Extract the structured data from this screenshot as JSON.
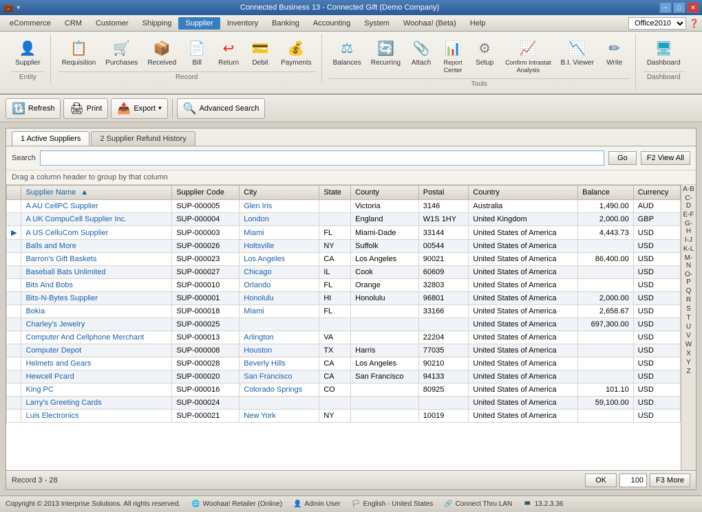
{
  "titlebar": {
    "title": "Connected Business 13 - Connected Gift (Demo Company)",
    "quick_access": [
      "save",
      "undo",
      "customize"
    ]
  },
  "menubar": {
    "items": [
      "eCommerce",
      "CRM",
      "Customer",
      "Shipping",
      "Supplier",
      "Inventory",
      "Banking",
      "Accounting",
      "System",
      "Woohaa! (Beta)",
      "Help"
    ],
    "active": "Supplier",
    "theme": "Office2010"
  },
  "ribbon": {
    "groups": [
      {
        "label": "Entity",
        "items": [
          {
            "id": "supplier",
            "label": "Supplier",
            "icon": "👤"
          }
        ]
      },
      {
        "label": "Record",
        "items": [
          {
            "id": "requisition",
            "label": "Requisition",
            "icon": "📋"
          },
          {
            "id": "purchases",
            "label": "Purchases",
            "icon": "🛒"
          },
          {
            "id": "received",
            "label": "Received",
            "icon": "📦"
          },
          {
            "id": "bill",
            "label": "Bill",
            "icon": "📄"
          },
          {
            "id": "return",
            "label": "Return",
            "icon": "↩"
          },
          {
            "id": "debit",
            "label": "Debit",
            "icon": "💳"
          },
          {
            "id": "payments",
            "label": "Payments",
            "icon": "💰"
          }
        ]
      },
      {
        "label": "Tools",
        "items": [
          {
            "id": "balances",
            "label": "Balances",
            "icon": "⚖"
          },
          {
            "id": "recurring",
            "label": "Recurring",
            "icon": "🔄"
          },
          {
            "id": "attach",
            "label": "Attach",
            "icon": "📎"
          },
          {
            "id": "report-center",
            "label": "Report\nCenter",
            "icon": "📊"
          },
          {
            "id": "setup",
            "label": "Setup",
            "icon": "⚙"
          },
          {
            "id": "confirm-intrastat",
            "label": "Confirm Intrastat\nAnalysis",
            "icon": "📈"
          },
          {
            "id": "bi-viewer",
            "label": "B.I. Viewer",
            "icon": "📉"
          },
          {
            "id": "write",
            "label": "Write",
            "icon": "✏"
          }
        ]
      },
      {
        "label": "Dashboard",
        "items": [
          {
            "id": "dashboard",
            "label": "Dashboard",
            "icon": "🖥"
          }
        ]
      }
    ]
  },
  "toolbar": {
    "refresh_label": "Refresh",
    "print_label": "Print",
    "export_label": "Export",
    "advanced_search_label": "Advanced Search"
  },
  "tabs": [
    {
      "id": "active-suppliers",
      "label": "1 Active Suppliers",
      "active": true
    },
    {
      "id": "supplier-refund",
      "label": "2 Supplier Refund History",
      "active": false
    }
  ],
  "search": {
    "label": "Search",
    "placeholder": "",
    "value": "",
    "go_label": "Go",
    "f2_label": "F2 View All"
  },
  "drag_hint": "Drag a column header to group by that column",
  "table": {
    "columns": [
      {
        "id": "name",
        "label": "Supplier Name",
        "sorted": true
      },
      {
        "id": "code",
        "label": "Supplier Code"
      },
      {
        "id": "city",
        "label": "City"
      },
      {
        "id": "state",
        "label": "State"
      },
      {
        "id": "county",
        "label": "County"
      },
      {
        "id": "postal",
        "label": "Postal"
      },
      {
        "id": "country",
        "label": "Country"
      },
      {
        "id": "balance",
        "label": "Balance"
      },
      {
        "id": "currency",
        "label": "Currency"
      }
    ],
    "rows": [
      {
        "name": "A AU CellPC Supplier",
        "code": "SUP-000005",
        "city": "Glen Iris",
        "state": "",
        "county": "Victoria",
        "postal": "3146",
        "country": "Australia",
        "balance": "1,490.00",
        "currency": "AUD",
        "selected": false,
        "arrow": false
      },
      {
        "name": "A UK CompuCell Supplier Inc.",
        "code": "SUP-000004",
        "city": "London",
        "state": "",
        "county": "England",
        "postal": "W1S 1HY",
        "country": "United Kingdom",
        "balance": "2,000.00",
        "currency": "GBP",
        "selected": false,
        "arrow": false
      },
      {
        "name": "A US CelluCom Supplier",
        "code": "SUP-000003",
        "city": "Miami",
        "state": "FL",
        "county": "Miami-Dade",
        "postal": "33144",
        "country": "United States of America",
        "balance": "4,443.73",
        "currency": "USD",
        "selected": false,
        "arrow": true
      },
      {
        "name": "Balls and More",
        "code": "SUP-000026",
        "city": "Holtsville",
        "state": "NY",
        "county": "Suffolk",
        "postal": "00544",
        "country": "United States of America",
        "balance": "",
        "currency": "USD",
        "selected": false,
        "arrow": false
      },
      {
        "name": "Barron's Gift Baskets",
        "code": "SUP-000023",
        "city": "Los Angeles",
        "state": "CA",
        "county": "Los Angeles",
        "postal": "90021",
        "country": "United States of America",
        "balance": "86,400.00",
        "currency": "USD",
        "selected": false,
        "arrow": false
      },
      {
        "name": "Baseball Bats Unlimited",
        "code": "SUP-000027",
        "city": "Chicago",
        "state": "IL",
        "county": "Cook",
        "postal": "60609",
        "country": "United States of America",
        "balance": "",
        "currency": "USD",
        "selected": false,
        "arrow": false
      },
      {
        "name": "Bits And Bobs",
        "code": "SUP-000010",
        "city": "Orlando",
        "state": "FL",
        "county": "Orange",
        "postal": "32803",
        "country": "United States of America",
        "balance": "",
        "currency": "USD",
        "selected": false,
        "arrow": false
      },
      {
        "name": "Bits-N-Bytes Supplier",
        "code": "SUP-000001",
        "city": "Honolulu",
        "state": "HI",
        "county": "Honolulu",
        "postal": "96801",
        "country": "United States of America",
        "balance": "2,000.00",
        "currency": "USD",
        "selected": false,
        "arrow": false
      },
      {
        "name": "Bokia",
        "code": "SUP-000018",
        "city": "Miami",
        "state": "FL",
        "county": "",
        "postal": "33166",
        "country": "United States of America",
        "balance": "2,658.67",
        "currency": "USD",
        "selected": false,
        "arrow": false
      },
      {
        "name": "Charley's Jewelry",
        "code": "SUP-000025",
        "city": "",
        "state": "",
        "county": "",
        "postal": "",
        "country": "United States of America",
        "balance": "697,300.00",
        "currency": "USD",
        "selected": false,
        "arrow": false
      },
      {
        "name": "Computer And Cellphone Merchant",
        "code": "SUP-000013",
        "city": "Arlington",
        "state": "VA",
        "county": "",
        "postal": "22204",
        "country": "United States of America",
        "balance": "",
        "currency": "USD",
        "selected": false,
        "arrow": false
      },
      {
        "name": "Computer Depot",
        "code": "SUP-000008",
        "city": "Houston",
        "state": "TX",
        "county": "Harris",
        "postal": "77035",
        "country": "United States of America",
        "balance": "",
        "currency": "USD",
        "selected": false,
        "arrow": false
      },
      {
        "name": "Helmets and Gears",
        "code": "SUP-000028",
        "city": "Beverly Hills",
        "state": "CA",
        "county": "Los Angeles",
        "postal": "90210",
        "country": "United States of America",
        "balance": "",
        "currency": "USD",
        "selected": false,
        "arrow": false
      },
      {
        "name": "Hewcell Pcard",
        "code": "SUP-000020",
        "city": "San Francisco",
        "state": "CA",
        "county": "San Francisco",
        "postal": "94133",
        "country": "United States of America",
        "balance": "",
        "currency": "USD",
        "selected": false,
        "arrow": false
      },
      {
        "name": "King PC",
        "code": "SUP-000016",
        "city": "Colorado Springs",
        "state": "CO",
        "county": "",
        "postal": "80925",
        "country": "United States of America",
        "balance": "101.10",
        "currency": "USD",
        "selected": false,
        "arrow": false
      },
      {
        "name": "Larry's Greeting Cards",
        "code": "SUP-000024",
        "city": "",
        "state": "",
        "county": "",
        "postal": "",
        "country": "United States of America",
        "balance": "59,100.00",
        "currency": "USD",
        "selected": false,
        "arrow": false
      },
      {
        "name": "Luis Electronics",
        "code": "SUP-000021",
        "city": "New York",
        "state": "NY",
        "county": "",
        "postal": "10019",
        "country": "United States of America",
        "balance": "",
        "currency": "USD",
        "selected": false,
        "arrow": false
      }
    ]
  },
  "alpha_bar": [
    "A-B",
    "C-D",
    "E-F",
    "G-H",
    "I-J",
    "K-L",
    "M-N",
    "O-P",
    "Q",
    "R",
    "S",
    "T",
    "U",
    "V",
    "W",
    "X",
    "Y",
    "Z"
  ],
  "status": {
    "record_label": "Record 3 - 28",
    "page_value": "100",
    "ok_label": "OK",
    "f3_label": "F3 More"
  },
  "footer": {
    "copyright": "Copyright © 2013 Interprise Solutions. All rights reserved.",
    "woohaa_status": "Woohaa! Retailer (Online)",
    "user": "Admin User",
    "language": "English - United States",
    "connection": "Connect Thru LAN",
    "version": "13.2.3.36"
  }
}
